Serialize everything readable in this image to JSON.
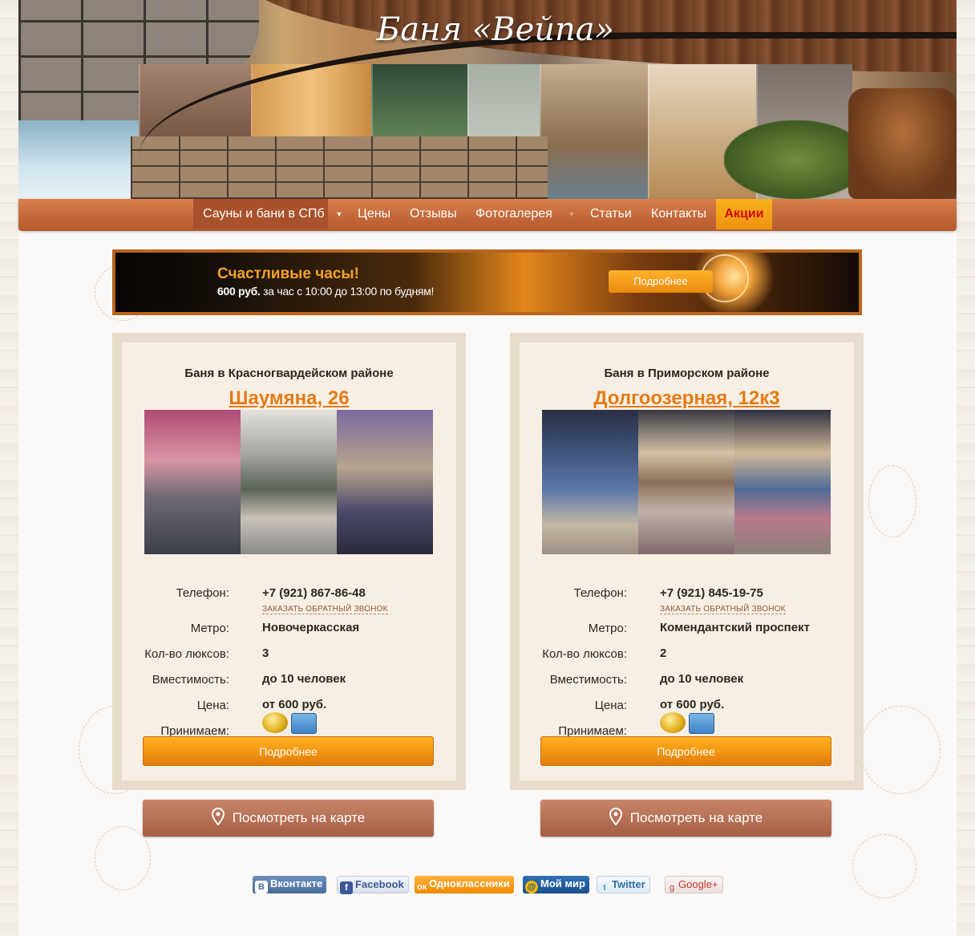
{
  "header": {
    "logo_text": "Баня «Вейпа»"
  },
  "nav": {
    "items": [
      {
        "label": "Сауны и бани в СПб"
      },
      {
        "label": "Цены"
      },
      {
        "label": "Отзывы"
      },
      {
        "label": "Фотогалерея"
      },
      {
        "label": "Статьи"
      },
      {
        "label": "Контакты"
      },
      {
        "label": "Акции"
      }
    ]
  },
  "promo": {
    "title": "Счастливые часы!",
    "price": "600 руб.",
    "text": " за час с 10:00 до 13:00 по будням!",
    "button": "Подробнее"
  },
  "cards": [
    {
      "subtitle": "Баня в Красногвардейском районе",
      "title": "Шаумяна, 26",
      "labels": {
        "phone": "Телефон:",
        "metro": "Метро:",
        "suites": "Кол-во люксов:",
        "capacity": "Вместимость:",
        "price": "Цена:",
        "accept": "Принимаем:"
      },
      "phone": "+7 (921) 867-86-48",
      "callback": "Заказать обратный звонок",
      "metro": "Новочеркасская",
      "suites": "3",
      "capacity": "до 10 человек",
      "price": "от 600 руб.",
      "button": "Подробнее",
      "map_button": "Посмотреть на карте"
    },
    {
      "subtitle": "Баня в Приморском районе",
      "title": "Долгоозерная, 12к3",
      "labels": {
        "phone": "Телефон:",
        "metro": "Метро:",
        "suites": "Кол-во люксов:",
        "capacity": "Вместимость:",
        "price": "Цена:",
        "accept": "Принимаем:"
      },
      "phone": "+7 (921) 845-19-75",
      "callback": "Заказать обратный звонок",
      "metro": "Комендантский проспект",
      "suites": "2",
      "capacity": "до 10 человек",
      "price": "от 600 руб.",
      "button": "Подробнее",
      "map_button": "Посмотреть на карте"
    }
  ],
  "social": [
    {
      "label": "Вконтакте",
      "icon": "В"
    },
    {
      "label": "Facebook",
      "icon": "f"
    },
    {
      "label": "Одноклассники",
      "icon": "ок"
    },
    {
      "label": "Мой мир",
      "icon": "@"
    },
    {
      "label": "Twitter",
      "icon": "t"
    },
    {
      "label": "Google+",
      "icon": "g"
    }
  ],
  "colors": {
    "nav": "#c4683a",
    "accent_orange": "#e57a14",
    "button": "#f29512",
    "map_button": "#b36a4f",
    "sale_text": "#d40b0b"
  }
}
